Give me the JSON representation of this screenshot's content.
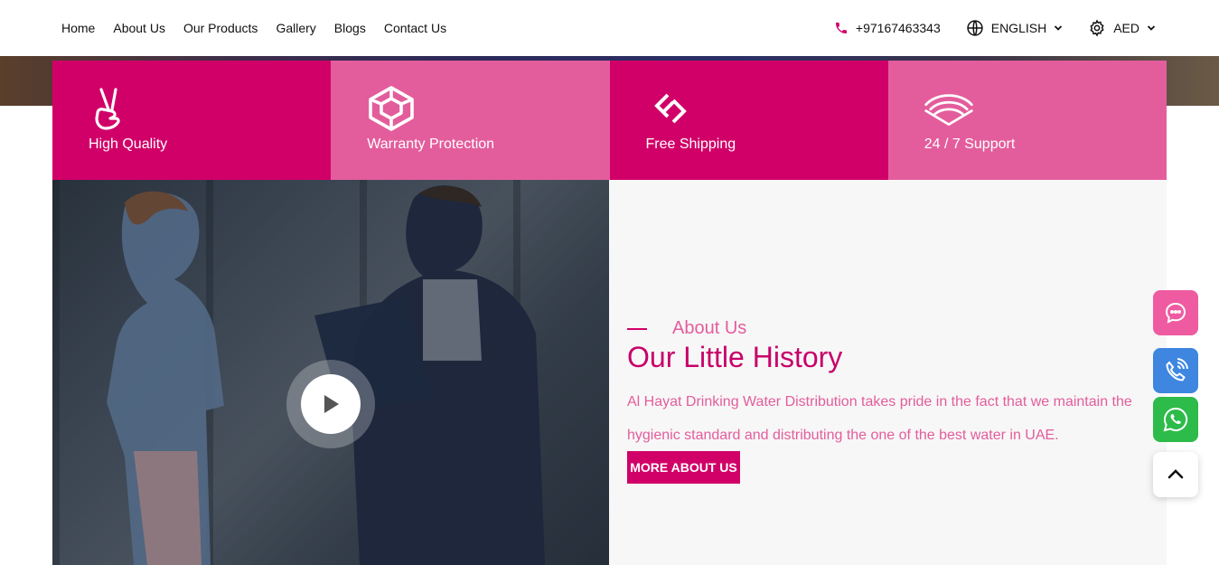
{
  "nav": {
    "items": [
      "Home",
      "About Us",
      "Our Products",
      "Gallery",
      "Blogs",
      "Contact Us"
    ]
  },
  "header": {
    "phone": "+97167463343",
    "language": "ENGLISH",
    "currency": "AED"
  },
  "features": [
    {
      "label": "High Quality",
      "icon": "peace-hand-icon"
    },
    {
      "label": "Warranty Protection",
      "icon": "cube-icon"
    },
    {
      "label": "Free Shipping",
      "icon": "link-arrows-icon"
    },
    {
      "label": "24 / 7 Support",
      "icon": "wifi-signal-icon"
    }
  ],
  "about": {
    "kicker": "About Us",
    "title": "Our Little History",
    "description": "Al Hayat Drinking Water Distribution takes pride in the fact that we maintain the hygienic standard and distributing the one of the best water in UAE.",
    "button_label": "MORE ABOUT US"
  },
  "colors": {
    "primary": "#d10068",
    "secondary": "#e35d9c",
    "chat": "#ef5ba1",
    "call": "#3e86e0",
    "whatsapp": "#2dbb4a"
  }
}
